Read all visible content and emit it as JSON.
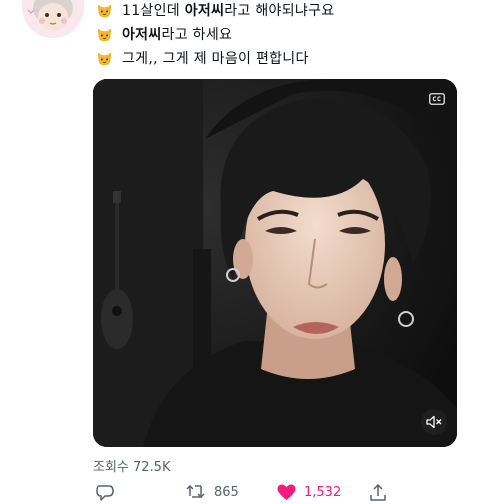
{
  "tweet": {
    "lines": [
      {
        "pre": "11살인데 ",
        "bold": "아저씨",
        "post": "라고 해야되냐구요"
      },
      {
        "pre": "",
        "bold": "아저씨",
        "post": "라고 하세요"
      },
      {
        "pre": "그게,, 그게 제 마음이 편합니다",
        "bold": "",
        "post": ""
      }
    ],
    "emoji_icon": "cat-face-icon"
  },
  "video": {
    "controls": {
      "captions_icon": "cc-icon",
      "mute_icon": "speaker-muted-icon"
    }
  },
  "stats": {
    "views": "조회수 72.5K"
  },
  "actions": {
    "retweets": "865",
    "likes": "1,532"
  },
  "colors": {
    "like": "#f91880",
    "muted_text": "#536471",
    "emoji": "#f5b62b"
  }
}
